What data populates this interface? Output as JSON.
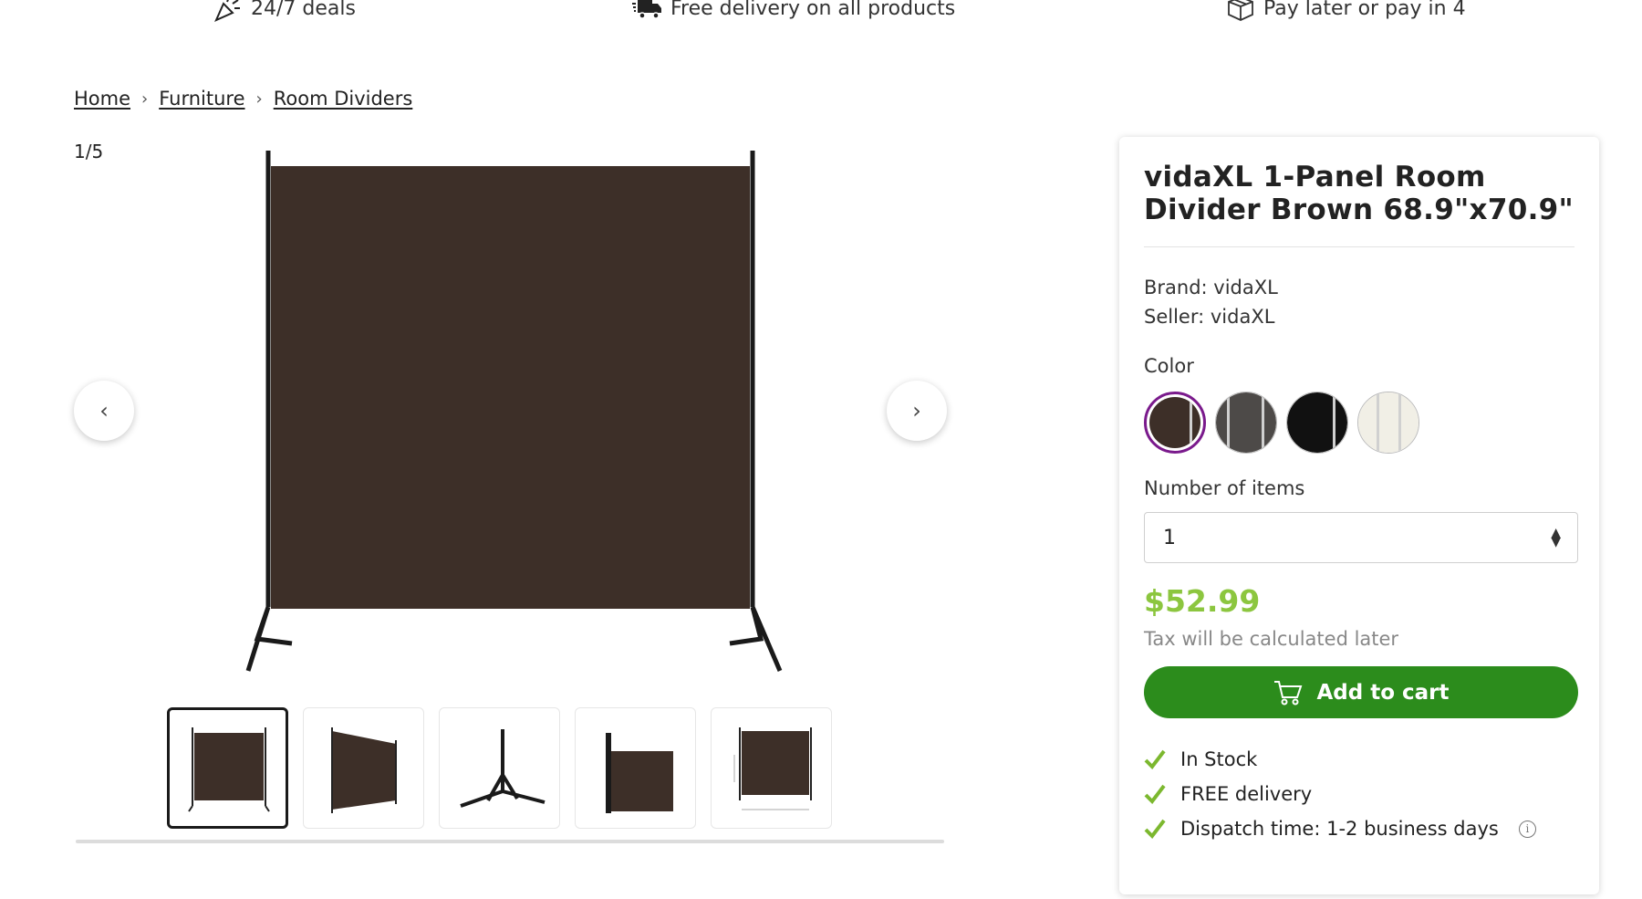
{
  "benefits": {
    "deals": "24/7 deals",
    "delivery": "Free delivery on all products",
    "pay_later": "Pay later or pay in 4"
  },
  "breadcrumb": [
    "Home",
    "Furniture",
    "Room Dividers"
  ],
  "gallery": {
    "counter": "1/5",
    "thumbnail_count": 5,
    "active_index": 0
  },
  "product": {
    "title": "vidaXL 1-Panel Room Divider Brown 68.9\"x70.9\"",
    "brand": "Brand: vidaXL",
    "seller": "Seller: vidaXL",
    "color_label": "Color",
    "colors": [
      {
        "name": "brown",
        "hex": "#3d2f28",
        "selected": true
      },
      {
        "name": "gray",
        "hex": "#4d4a48",
        "selected": false
      },
      {
        "name": "black",
        "hex": "#111111",
        "selected": false
      },
      {
        "name": "cream",
        "hex": "#f1efe6",
        "selected": false
      }
    ],
    "quantity_label": "Number of items",
    "quantity_value": "1",
    "price": "$52.99",
    "tax_note": "Tax will be calculated later",
    "add_to_cart": "Add to cart",
    "status": [
      "In Stock",
      "FREE delivery",
      "Dispatch time: 1-2 business days"
    ]
  },
  "colors": {
    "accent_green": "#2c8c1c",
    "price_green": "#8cc63f",
    "check_green": "#7cb82f",
    "selected_ring": "#7a1a8c",
    "panel_brown": "#3d2f28"
  }
}
